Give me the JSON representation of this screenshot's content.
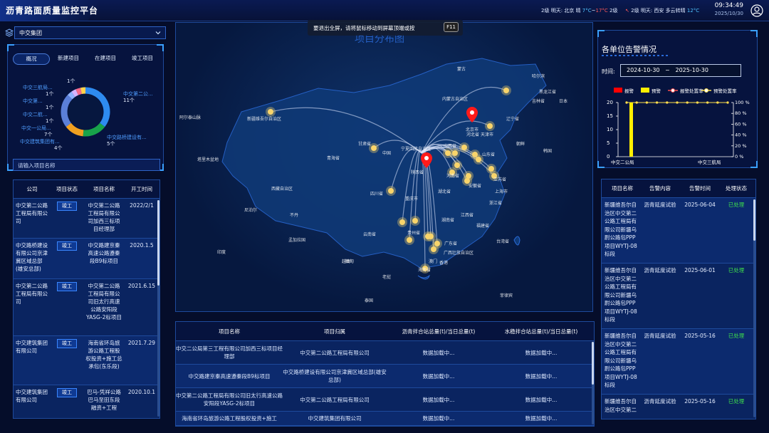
{
  "header": {
    "app_title": "沥青路面质量监控平台",
    "weather_beijing": {
      "level": "2级",
      "day": "明天:",
      "city": "北京",
      "cond": "晴",
      "hi": "7°C",
      "sep": "~",
      "lo": "17°C",
      "level2": "2级"
    },
    "weather_xian": {
      "arrow": "↖",
      "level": "2级",
      "day": "明天:",
      "city": "西安",
      "cond": "多云转晴",
      "temp": "12°C"
    },
    "time": "09:34:49",
    "date": "2025/10/30"
  },
  "left": {
    "company_select": "中交集团",
    "tabs": [
      "概况",
      "新建项目",
      "在建项目",
      "竣工项目"
    ],
    "donut": {
      "labels": [
        {
          "name": "中交三航局...",
          "count": "1个"
        },
        {
          "name": "中交第...",
          "count": "1个"
        },
        {
          "name": "中交二航...",
          "count": "1个"
        },
        {
          "name": "中交一公局...",
          "count": "7个"
        },
        {
          "name": "中交建筑集团有...",
          "count": "4个"
        },
        {
          "name": "",
          "count": "1个"
        },
        {
          "name": "中交第二公...",
          "count": "11个"
        },
        {
          "name": "中交路桥建设有...",
          "count": "5个"
        }
      ],
      "slices": [
        {
          "value": 11,
          "color": "#2e8bf0"
        },
        {
          "value": 5,
          "color": "#18a34a"
        },
        {
          "value": 4,
          "color": "#f0a020"
        },
        {
          "value": 7,
          "color": "#5b7fd8"
        },
        {
          "value": 1,
          "color": "#8fb3ff"
        },
        {
          "value": 1,
          "color": "#d6b4ff"
        },
        {
          "value": 1,
          "color": "#f76b8a"
        },
        {
          "value": 1,
          "color": "#ffd34d"
        }
      ]
    },
    "search_placeholder": "请输入项目名称",
    "table": {
      "headers": [
        "公司",
        "项目状态",
        "项目名称",
        "开工时间"
      ],
      "rows": [
        {
          "company": "中交第二公路工程局有限公司",
          "status": "竣工",
          "name": "中交第二公路工程局有限公司加西三标项目经理部",
          "date": "2022/2/1"
        },
        {
          "company": "中交路桥建设有限公司京津冀区域总部(雄安总部)",
          "status": "竣工",
          "name": "中交路建京秦高速公路遵秦段B9标项目",
          "date": "2020.1.5"
        },
        {
          "company": "中交第二公路工程局有限公司",
          "status": "竣工",
          "name": "中交第二公路工程局有限公司旧太行高速公路安阳段YASG-2标项目",
          "date": "2021.6.15"
        },
        {
          "company": "中交建筑集团有限公司",
          "status": "竣工",
          "name": "海南省环岛旅游公路工程股权投资+施工总承包(东乐段)",
          "date": "2021.7.29"
        },
        {
          "company": "中交建筑集团有限公司",
          "status": "竣工",
          "name": "巴马-凭祥公路巴马至田东段融资+工程",
          "date": "2020.10.1"
        }
      ]
    }
  },
  "map": {
    "title": "项目分布图",
    "fullscreen_tip": "要退出全屏，请将鼠标移动到屏幕顶端或按",
    "fullscreen_key": "F11",
    "labels": [
      "哈尔滨",
      "黑龙江省",
      "内蒙古自治区",
      "吉林省",
      "辽宁省",
      "北京市",
      "河北省",
      "天津市",
      "山西省",
      "宁夏回族自治区",
      "甘肃省",
      "中国",
      "青海省",
      "新疆维吾尔自治区",
      "阿尔泰山脉",
      "塔里木盆地",
      "西藏自治区",
      "四川省",
      "重庆市",
      "湖北省",
      "安徽省",
      "上海市",
      "浙江省",
      "江西省",
      "湖南省",
      "福建省",
      "云南省",
      "广东省",
      "广西壮族自治区",
      "台湾省",
      "海南省",
      "越南",
      "老挝",
      "泰国",
      "缅甸",
      "印度",
      "尼泊尔",
      "不丹",
      "孟加拉国",
      "菲律宾",
      "朝鲜",
      "韩国",
      "日本",
      "山东省",
      "江苏省",
      "贵州省",
      "陕西省",
      "河南省",
      "香港",
      "澳门",
      "蒙古"
    ]
  },
  "bottom_table": {
    "headers": [
      "项目名称",
      "项目归属",
      "沥青拌合站总量(t)/当日总量(t)",
      "水稳拌合站总量(t)/当日总量(t)"
    ],
    "rows": [
      {
        "name": "中交二公局第三工程有限公司加西三标项目经理部",
        "owner": "中交第二公路工程局有限公司",
        "asphalt": "数据加载中...",
        "water": "数据加载中..."
      },
      {
        "name": "中交路建京秦高速遵秦段B9标项目",
        "owner": "中交路桥建设有限公司京津冀区域总部(雄安总部)",
        "asphalt": "数据加载中...",
        "water": "数据加载中..."
      },
      {
        "name": "中交第二公路工程局有限公司旧太行高速公路安阳段YASG-2标项目",
        "owner": "中交第二公路工程局有限公司",
        "asphalt": "数据加载中...",
        "water": "数据加载中..."
      },
      {
        "name": "海南省环岛旅游公路工程股权投资+施工",
        "owner": "中交建筑集团有限公司",
        "asphalt": "数据加载中...",
        "water": "数据加载中..."
      }
    ]
  },
  "right": {
    "title": "各单位告警情况",
    "time_label": "时间:",
    "date_start": "2024-10-30",
    "date_sep": "~",
    "date_end": "2025-10-30",
    "chart_data": {
      "type": "bar",
      "legend": [
        "报警",
        "预警",
        "报警处置率",
        "预警处置率"
      ],
      "categories": [
        "中交二公局",
        "中交三航局"
      ],
      "series": [
        {
          "name": "报警",
          "values": [
            0,
            0
          ],
          "color": "#ff0000"
        },
        {
          "name": "预警",
          "values": [
            20,
            0
          ],
          "color": "#ffee00"
        }
      ],
      "rate_series": [
        {
          "name": "报警处置率",
          "values": [
            100,
            100,
            100,
            100,
            100,
            100,
            100,
            100,
            100,
            100,
            100
          ],
          "color": "#ff4d4d"
        },
        {
          "name": "预警处置率",
          "values": [
            100,
            100,
            100,
            100,
            100,
            100,
            100,
            100,
            100,
            100,
            100
          ],
          "color": "#ffe14d"
        }
      ],
      "y_ticks": [
        "20",
        "15",
        "10",
        "5",
        "0"
      ],
      "y2_ticks": [
        "100 %",
        "80 %",
        "60 %",
        "40 %",
        "20 %",
        "0 %"
      ],
      "ylim": [
        0,
        20
      ],
      "y2lim": [
        0,
        100
      ]
    },
    "table": {
      "headers": [
        "项目名称",
        "告警内容",
        "告警时间",
        "处理状态"
      ],
      "rows": [
        {
          "name": "新疆维吾尔自治区中交第二公路工程局有限公司新疆乌尉公路包PPP项目WYTJ-08标段",
          "content": "沥青延度试验",
          "time": "2025-06-04",
          "status": "已处理"
        },
        {
          "name": "新疆维吾尔自治区中交第二公路工程局有限公司新疆乌尉公路包PPP项目WYTJ-08标段",
          "content": "沥青延度试验",
          "time": "2025-06-01",
          "status": "已处理"
        },
        {
          "name": "新疆维吾尔自治区中交第二公路工程局有限公司新疆乌尉公路包PPP项目WYTJ-08标段",
          "content": "沥青延度试验",
          "time": "2025-05-16",
          "status": "已处理"
        },
        {
          "name": "新疆维吾尔自治区中交第二",
          "content": "沥青延度试验",
          "time": "2025-05-16",
          "status": "已处理"
        }
      ]
    }
  }
}
